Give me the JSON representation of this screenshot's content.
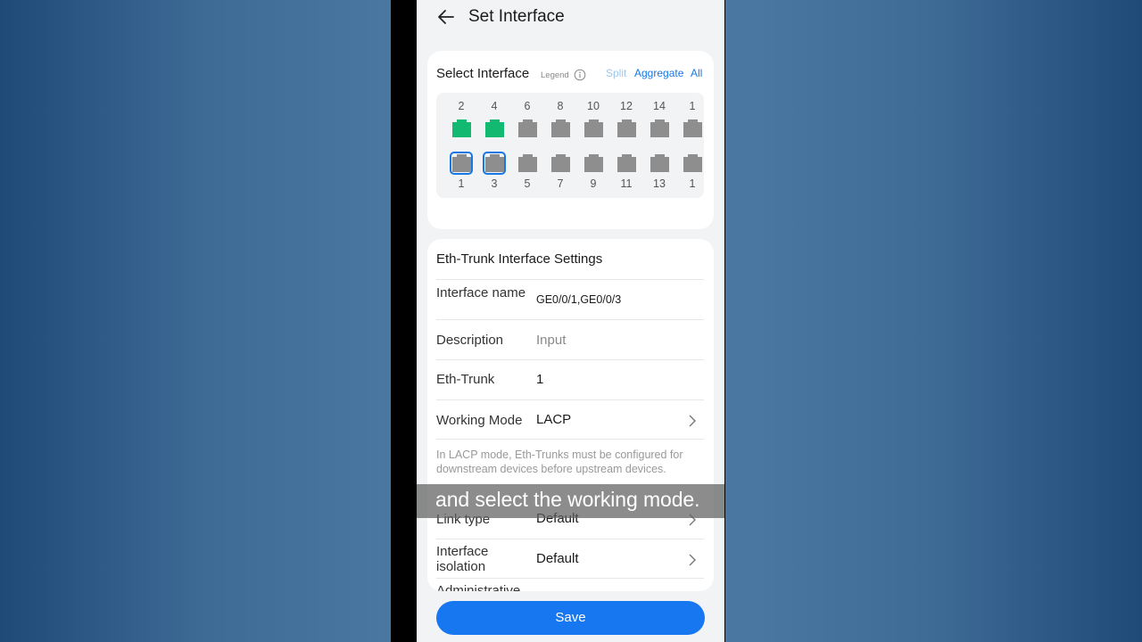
{
  "header": {
    "title": "Set Interface"
  },
  "select_interface": {
    "title": "Select Interface",
    "legend": "Legend",
    "options": {
      "split": "Split",
      "aggregate": "Aggregate",
      "all": "All"
    },
    "top_ports": [
      {
        "number": "2",
        "state": "active"
      },
      {
        "number": "4",
        "state": "active"
      },
      {
        "number": "6",
        "state": "inactive"
      },
      {
        "number": "8",
        "state": "inactive"
      },
      {
        "number": "10",
        "state": "inactive"
      },
      {
        "number": "12",
        "state": "inactive"
      },
      {
        "number": "14",
        "state": "inactive"
      },
      {
        "number": "1",
        "state": "inactive"
      }
    ],
    "bottom_ports": [
      {
        "number": "1",
        "state": "selected"
      },
      {
        "number": "3",
        "state": "selected"
      },
      {
        "number": "5",
        "state": "inactive"
      },
      {
        "number": "7",
        "state": "inactive"
      },
      {
        "number": "9",
        "state": "inactive"
      },
      {
        "number": "11",
        "state": "inactive"
      },
      {
        "number": "13",
        "state": "inactive"
      },
      {
        "number": "1",
        "state": "inactive"
      }
    ],
    "colors": {
      "active": "#12b970",
      "inactive": "#8e8e8e",
      "selected_border": "#1677e5"
    }
  },
  "settings": {
    "title": "Eth-Trunk Interface Settings",
    "interface_name": {
      "label": "Interface name",
      "value": "GE0/0/1,GE0/0/3"
    },
    "description": {
      "label": "Description",
      "placeholder": "Input"
    },
    "eth_trunk": {
      "label": "Eth-Trunk",
      "value": "1"
    },
    "working_mode": {
      "label": "Working Mode",
      "value": "LACP"
    },
    "hint": "In LACP mode, Eth-Trunks must be configured for downstream devices before upstream devices.",
    "link_type": {
      "label": "Link type",
      "value": "Default"
    },
    "interface_isolation": {
      "label": "Interface isolation",
      "value": "Default"
    },
    "administrative": {
      "label": "Administrative"
    }
  },
  "save_label": "Save",
  "caption": "and select the working mode.",
  "accent_color": "#1677f0"
}
